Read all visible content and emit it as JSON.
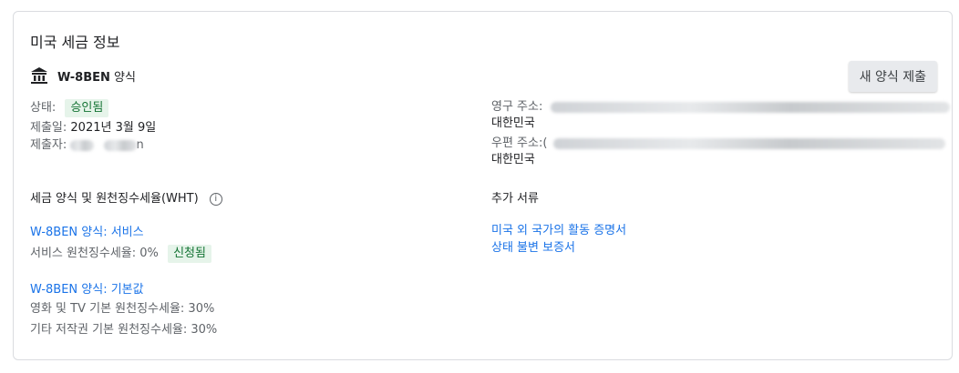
{
  "card": {
    "title": "미국 세금 정보",
    "form_name_bold": "W-8BEN",
    "form_name_suffix": " 양식",
    "new_form_button": "새 양식 제출"
  },
  "status": {
    "status_label": "상태:",
    "status_value": "승인됨",
    "submitted_label": "제출일:",
    "submitted_value": "2021년 3월 9일",
    "submitter_label": "제출자:",
    "submitter_tail": "n"
  },
  "address": {
    "permanent_label": "영구 주소:",
    "permanent_country": "대한민국",
    "mailing_label": "우편 주소:",
    "mailing_country": "대한민국",
    "mailing_prefix": "("
  },
  "wht": {
    "heading": "세금 양식 및 원천징수세율(WHT)",
    "service_link": "W-8BEN 양식: 서비스",
    "service_rate": "서비스 원천징수세율: 0%",
    "service_badge": "신청됨",
    "default_link": "W-8BEN 양식: 기본값",
    "film_tv_rate": "영화 및 TV 기본 원천징수세율: 30%",
    "other_copyright_rate": "기타 저작권 기본 원천징수세율: 30%"
  },
  "additional": {
    "heading": "추가 서류",
    "doc1": "미국 외 국가의 활동 증명서",
    "doc2": "상태 불변 보증서"
  },
  "colors": {
    "accent": "#1a73e8",
    "success_bg": "#e6f4ea",
    "success_text": "#137333"
  }
}
